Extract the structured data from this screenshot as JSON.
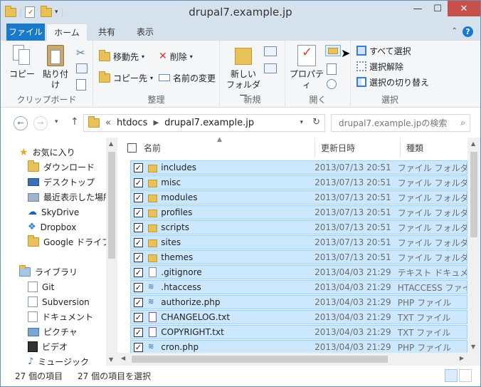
{
  "window": {
    "title": "drupal7.example.jp"
  },
  "controls": {
    "minimize": "—",
    "maximize": "☐",
    "close": "✕"
  },
  "tabs": [
    {
      "label": "ファイル"
    },
    {
      "label": "ホーム"
    },
    {
      "label": "共有"
    },
    {
      "label": "表示"
    }
  ],
  "ribbon": {
    "clipboard": {
      "group": "クリップボード",
      "copy": "コピー",
      "paste": "貼り付け"
    },
    "organize": {
      "group": "整理",
      "move_to": "移動先",
      "copy_to": "コピー先",
      "delete": "削除",
      "rename": "名前の変更"
    },
    "new": {
      "group": "新規",
      "new_folder_line1": "新しい",
      "new_folder_line2": "フォルダー"
    },
    "open": {
      "group": "開く",
      "properties": "プロパティ"
    },
    "select": {
      "group": "選択",
      "select_all": "すべて選択",
      "select_none": "選択解除",
      "invert": "選択の切り替え"
    }
  },
  "address": {
    "chevron": "«",
    "crumbs": [
      "htdocs",
      "drupal7.example.jp"
    ]
  },
  "search": {
    "placeholder": "drupal7.example.jpの検索"
  },
  "nav": {
    "favorites": "お気に入り",
    "downloads": "ダウンロード",
    "desktop": "デスクトップ",
    "recent": "最近表示した場所",
    "skydrive": "SkyDrive",
    "dropbox": "Dropbox",
    "gdrive": "Google ドライブ",
    "libraries": "ライブラリ",
    "git": "Git",
    "subversion": "Subversion",
    "documents": "ドキュメント",
    "pictures": "ピクチャ",
    "videos": "ビデオ",
    "music": "ミュージック"
  },
  "columns": {
    "name": "名前",
    "modified": "更新日時",
    "type": "種類"
  },
  "files": [
    {
      "name": "includes",
      "date": "2013/07/13 20:51",
      "type": "ファイル フォルダー",
      "icon": "folder"
    },
    {
      "name": "misc",
      "date": "2013/07/13 20:51",
      "type": "ファイル フォルダー",
      "icon": "folder"
    },
    {
      "name": "modules",
      "date": "2013/07/13 20:51",
      "type": "ファイル フォルダー",
      "icon": "folder"
    },
    {
      "name": "profiles",
      "date": "2013/07/13 20:51",
      "type": "ファイル フォルダー",
      "icon": "folder"
    },
    {
      "name": "scripts",
      "date": "2013/07/13 20:51",
      "type": "ファイル フォルダー",
      "icon": "folder"
    },
    {
      "name": "sites",
      "date": "2013/07/13 20:51",
      "type": "ファイル フォルダー",
      "icon": "folder"
    },
    {
      "name": "themes",
      "date": "2013/07/13 20:51",
      "type": "ファイル フォルダー",
      "icon": "folder"
    },
    {
      "name": ".gitignore",
      "date": "2013/04/03 21:29",
      "type": "テキスト ドキュメント",
      "icon": "file"
    },
    {
      "name": ".htaccess",
      "date": "2013/04/03 21:29",
      "type": "HTACCESS ファイル",
      "icon": "php"
    },
    {
      "name": "authorize.php",
      "date": "2013/04/03 21:29",
      "type": "PHP ファイル",
      "icon": "php"
    },
    {
      "name": "CHANGELOG.txt",
      "date": "2013/04/03 21:29",
      "type": "TXT ファイル",
      "icon": "txt"
    },
    {
      "name": "COPYRIGHT.txt",
      "date": "2013/04/03 21:29",
      "type": "TXT ファイル",
      "icon": "txt"
    },
    {
      "name": "cron.php",
      "date": "2013/04/03 21:29",
      "type": "PHP ファイル",
      "icon": "php"
    }
  ],
  "status": {
    "count": "27 個の項目",
    "selected": "27 個の項目を選択"
  }
}
